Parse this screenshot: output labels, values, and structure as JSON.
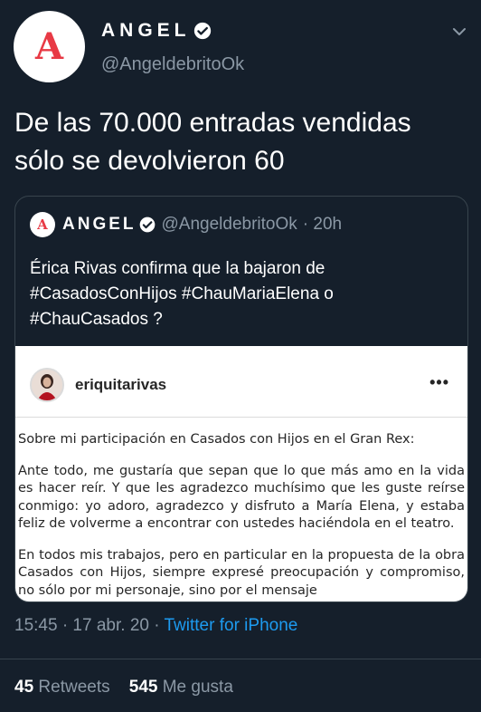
{
  "author": {
    "avatar_letter": "A",
    "name": "ANGEL",
    "handle": "@AngeldebritoOk"
  },
  "tweet": {
    "text_line1": "De las 70.000 entradas vendidas",
    "text_line2": "sólo se devolvieron 60"
  },
  "quote": {
    "avatar_letter": "A",
    "name": "ANGEL",
    "handle": "@AngeldebritoOk",
    "time": "· 20h",
    "text_line1": "Érica Rivas confirma que la bajaron de",
    "text_line2": "#CasadosConHijos #ChauMariaElena o",
    "text_line3": "#ChauCasados ?",
    "image": {
      "username": "eriquitarivas",
      "more": "•••",
      "p1": "Sobre mi participación en Casados con Hijos en el Gran Rex:",
      "p2": "Ante todo, me gustaría que sepan que lo que más amo en la vida es hacer reír. Y que les agradezco muchísimo que les guste reírse conmigo: yo adoro, agradezco y disfruto a María Elena, y estaba feliz de volverme a encontrar con ustedes haciéndola en el teatro.",
      "p3": "En todos mis trabajos, pero en particular en la propuesta de la obra Casados con Hijos, siempre expresé preocupación y compromiso, no sólo por mi personaje, sino por el mensaje"
    }
  },
  "meta": {
    "timestamp": "15:45 · 17 abr. 20 · ",
    "source": "Twitter for iPhone"
  },
  "stats": {
    "retweets_count": "45",
    "retweets_label": "Retweets",
    "likes_count": "545",
    "likes_label": "Me gusta"
  },
  "colors": {
    "background": "#151f2b",
    "secondary_text": "#8b98a5",
    "link": "#1d9bf0",
    "brand_red": "#e83a45"
  }
}
